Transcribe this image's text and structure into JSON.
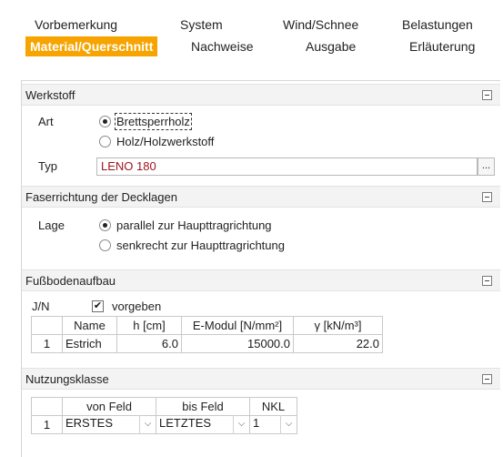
{
  "tabs": {
    "vorbemerkung": "Vorbemerkung",
    "system": "System",
    "wind_schnee": "Wind/Schnee",
    "belastungen": "Belastungen",
    "material_querschnitt": "Material/Querschnitt",
    "nachweise": "Nachweise",
    "ausgabe": "Ausgabe",
    "erlaeuterung": "Erläuterung"
  },
  "werkstoff": {
    "title": "Werkstoff",
    "art_label": "Art",
    "option_brettsperrholz": "Brettsperrholz",
    "option_holz": "Holz/Holzwerkstoff",
    "typ_label": "Typ",
    "typ_value": "LENO 180",
    "browse_label": "..."
  },
  "faserrichtung": {
    "title": "Faserrichtung der Decklagen",
    "lage_label": "Lage",
    "option_parallel": "parallel zur Haupttragrichtung",
    "option_senkrecht": "senkrecht zur Haupttragrichtung"
  },
  "fussboden": {
    "title": "Fußbodenaufbau",
    "jn_label": "J/N",
    "check_mark": "✔",
    "vorgeben_label": "vorgeben",
    "columns": [
      "Name",
      "h [cm]",
      "E-Modul [N/mm²]",
      "γ [kN/m³]"
    ],
    "rows": [
      {
        "no": "1",
        "name": "Estrich",
        "h": "6.0",
        "emodul": "15000.0",
        "gamma": "22.0"
      }
    ]
  },
  "nutzungsklasse": {
    "title": "Nutzungsklasse",
    "columns": [
      "von Feld",
      "bis Feld",
      "NKL"
    ],
    "rows": [
      {
        "no": "1",
        "von": "ERSTES",
        "bis": "LETZTES",
        "nkl": "1"
      }
    ],
    "arrow_glyph": "⌵"
  },
  "colors": {
    "active_tab": "#f7a400",
    "typ_value_text": "#a0141e",
    "section_bg": "#f3f3f3"
  }
}
